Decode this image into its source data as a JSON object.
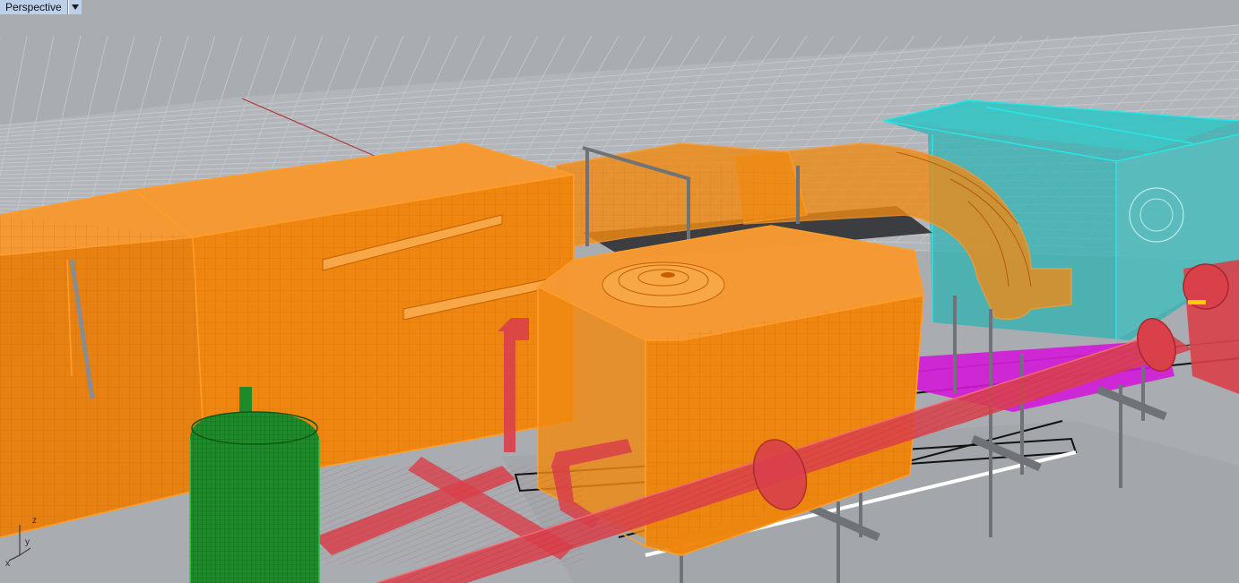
{
  "viewport": {
    "title": "Perspective",
    "menu_icon": "chevron-down-icon",
    "background": "#a9acb1"
  },
  "axes_widget": {
    "x_label": "x",
    "y_label": "y",
    "z_label": "z"
  },
  "colors": {
    "duct_orange": "#f08a12",
    "ahu_cyan": "#2fb3b3",
    "pipe_red": "#d9404a",
    "tank_green": "#1e8a2a",
    "magenta_strip": "#d21ad8",
    "grid_line": "#c4c7cc"
  },
  "objects": [
    "main-supply-duct",
    "mixing-plenum",
    "air-handling-unit",
    "round-elbow-duct",
    "main-pipe",
    "branch-pipe",
    "expansion-tank",
    "support-hangers"
  ]
}
